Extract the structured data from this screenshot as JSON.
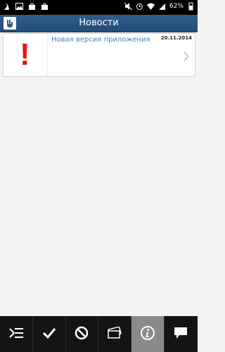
{
  "statusbar": {
    "battery": "62%",
    "icons_left": [
      "cleaner-icon",
      "image-icon",
      "bag-icon",
      "bag-icon"
    ],
    "icons_right": [
      "mute-icon",
      "alarm-icon",
      "wifi-icon",
      "roaming-icon",
      "signal-icon"
    ]
  },
  "header": {
    "title": "Новости"
  },
  "news": [
    {
      "headline": "Новая версия приложения",
      "date": "20.11.2014"
    }
  ],
  "toolbar": {
    "buttons": [
      "menu-icon",
      "check-icon",
      "block-icon",
      "tickets-icon",
      "info-icon",
      "chat-icon"
    ],
    "active_index": 4
  },
  "colors": {
    "header": "#2f5d8c",
    "link": "#3e84c0",
    "alert": "#e4141b"
  }
}
